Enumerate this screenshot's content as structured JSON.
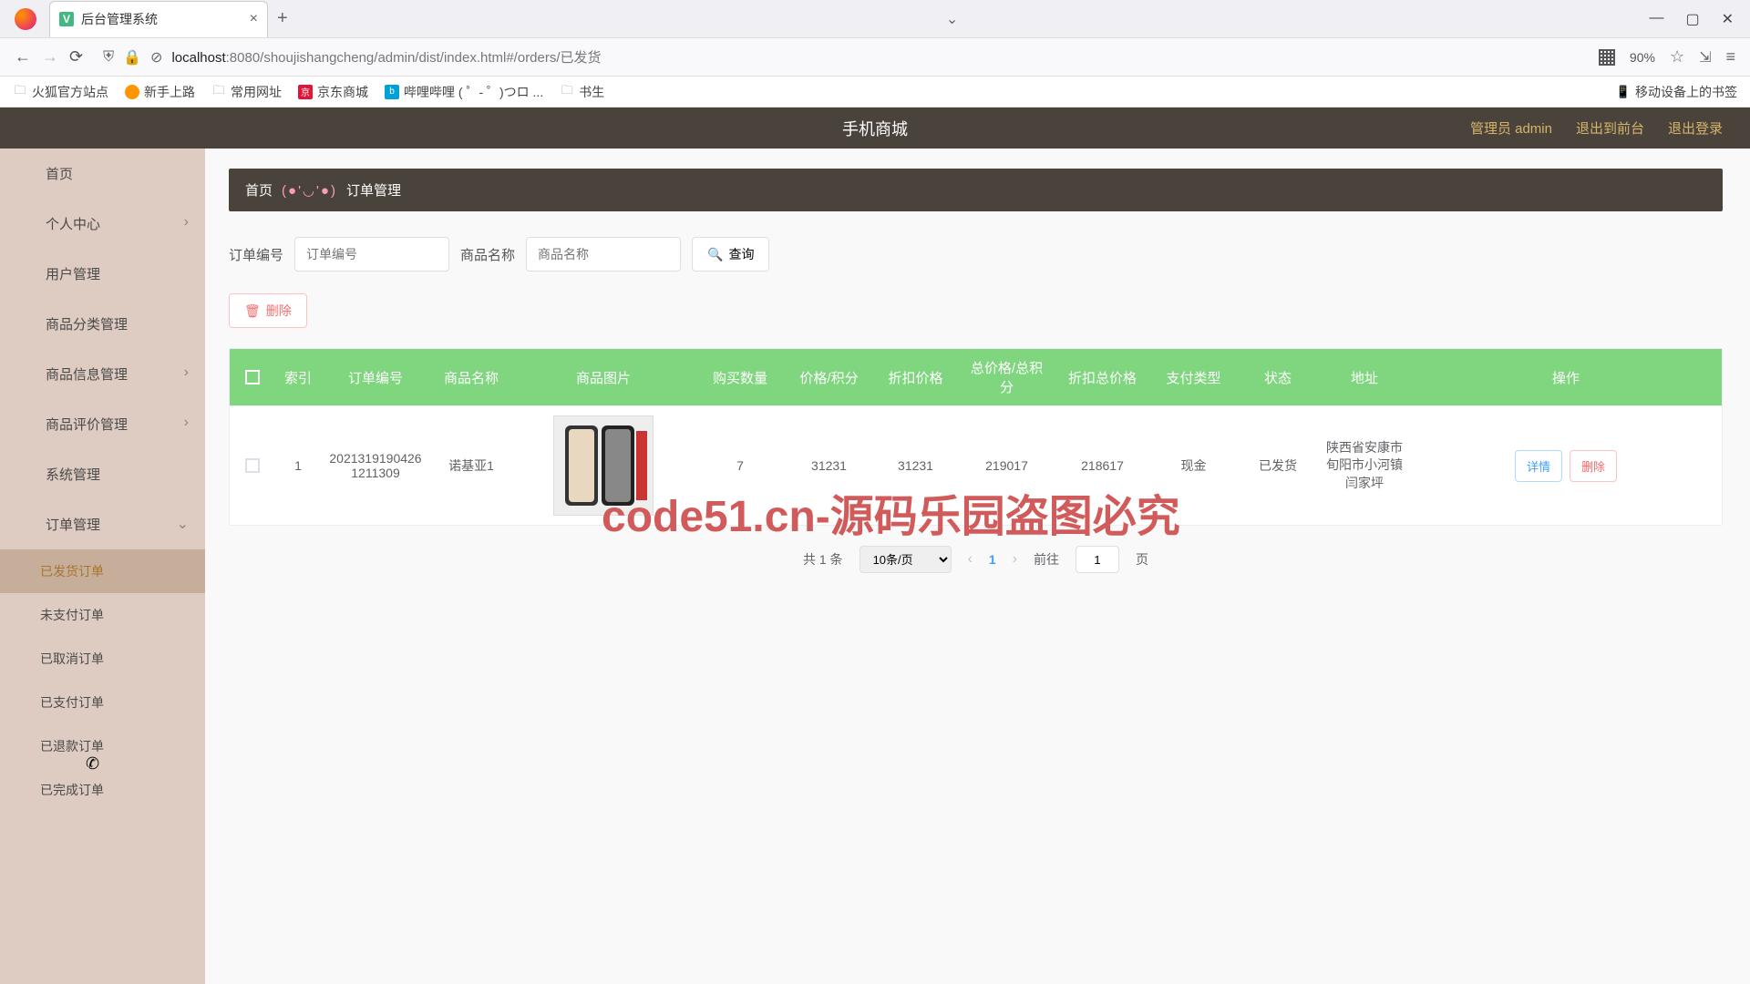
{
  "browser": {
    "tab_title": "后台管理系统",
    "url_host": "localhost",
    "url_rest": ":8080/shoujishangcheng/admin/dist/index.html#/orders/已发货",
    "zoom": "90%",
    "bookmarks": {
      "b1": "火狐官方站点",
      "b2": "新手上路",
      "b3": "常用网址",
      "b4": "京东商城",
      "b5": "哔哩哔哩 (  ゜- ゜)つロ ...",
      "b6": "书生",
      "mobile": "移动设备上的书签"
    }
  },
  "header": {
    "title": "手机商城",
    "admin": "管理员 admin",
    "to_front": "退出到前台",
    "logout": "退出登录"
  },
  "sidebar": {
    "home": "首页",
    "personal": "个人中心",
    "user": "用户管理",
    "category": "商品分类管理",
    "product": "商品信息管理",
    "review": "商品评价管理",
    "system": "系统管理",
    "order": "订单管理",
    "sub": {
      "shipped": "已发货订单",
      "unpaid": "未支付订单",
      "cancelled": "已取消订单",
      "paid": "已支付订单",
      "refunded": "已退款订单",
      "done": "已完成订单"
    }
  },
  "breadcrumb": {
    "home": "首页",
    "emoji": "(●'◡'●)",
    "current": "订单管理"
  },
  "filter": {
    "order_label": "订单编号",
    "order_ph": "订单编号",
    "product_label": "商品名称",
    "product_ph": "商品名称",
    "search": "查询",
    "delete": "删除"
  },
  "table": {
    "headers": {
      "idx": "索引",
      "ono": "订单编号",
      "pname": "商品名称",
      "img": "商品图片",
      "qty": "购买数量",
      "pp": "价格/积分",
      "disc": "折扣价格",
      "tpp": "总价格/总积分",
      "tdisc": "折扣总价格",
      "ptype": "支付类型",
      "stat": "状态",
      "addr": "地址",
      "ops": "操作"
    },
    "row": {
      "idx": "1",
      "ono": "20213191904261211309",
      "pname": "诺基亚1",
      "qty": "7",
      "pp": "31231",
      "disc": "31231",
      "tpp": "219017",
      "tdisc": "218617",
      "ptype": "现金",
      "stat": "已发货",
      "addr": "陕西省安康市旬阳市小河镇闫家坪",
      "detail": "详情",
      "delete": "删除"
    }
  },
  "pagination": {
    "total": "共 1 条",
    "page_size": "10条/页",
    "current": "1",
    "goto": "前往",
    "page_label": "页",
    "jump_val": "1"
  },
  "watermark": {
    "text": "code51.cn",
    "big": "code51.cn-源码乐园盗图必究"
  }
}
